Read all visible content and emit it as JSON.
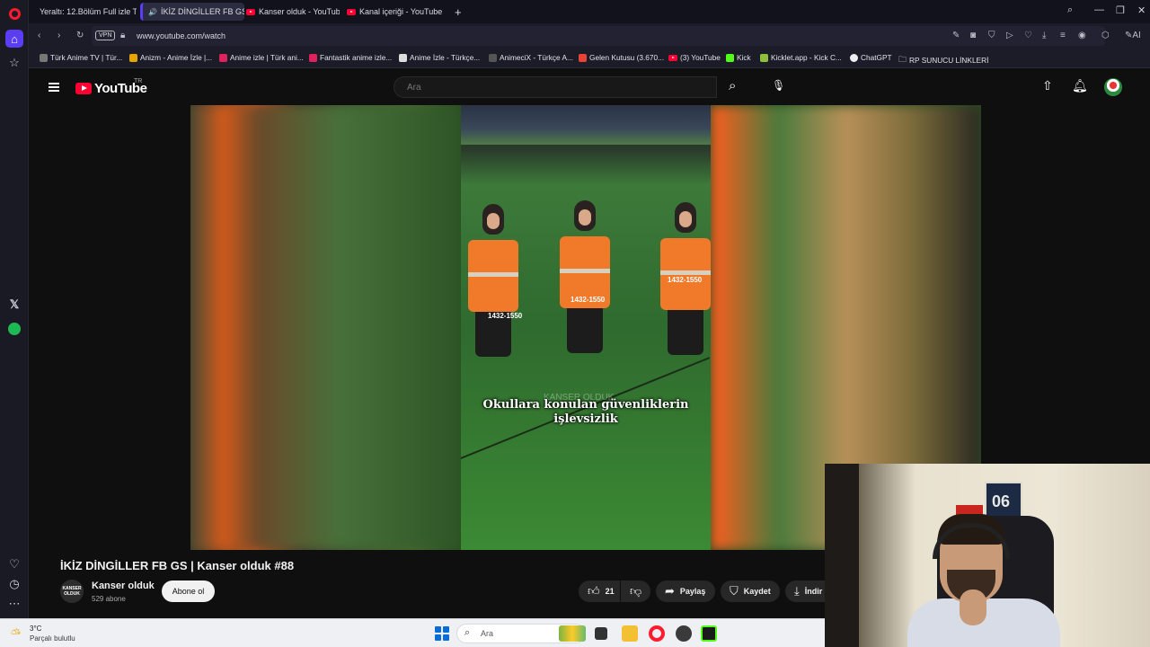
{
  "tabs": [
    {
      "label": "Yeraltı: 12.Bölüm Full izle T",
      "active": false
    },
    {
      "label": "İKİZ DİNGİLLER FB GS",
      "active": true
    },
    {
      "label": "Kanser olduk - YouTube",
      "active": false
    },
    {
      "label": "Kanal içeriği - YouTube St",
      "active": false
    }
  ],
  "address": {
    "vpn": "VPN",
    "url": "www.youtube.com/watch",
    "ai": "AI"
  },
  "bookmarks": [
    "Türk Anime TV | Tür...",
    "Anizm - Anime İzle |...",
    "Anime izle | Türk ani...",
    "Fantastik anime izle...",
    "Anime İzle - Türkçe...",
    "AnimeciX - Türkçe A...",
    "Gelen Kutusu (3.670...",
    "(3) YouTube",
    "Kick",
    "Kicklet.app - Kick C...",
    "ChatGPT",
    "RP SUNUCU LİNKLERİ"
  ],
  "youtube": {
    "logo": "YouTube",
    "region": "TR",
    "search_placeholder": "Ara"
  },
  "video": {
    "caption_line1": "Okullara konulan güvenliklerin",
    "caption_line2": "işlevsizlik",
    "watermark": "KANSER OLDUK",
    "vest_number": "1432-1550"
  },
  "meta": {
    "title": "İKİZ DİNGİLLER FB GS | Kanser olduk #88",
    "channel_avatar_text": "KANSER OLDUK",
    "channel": "Kanser olduk",
    "subscribers": "529 abone",
    "subscribe": "Abone ol",
    "likes": "21",
    "share": "Paylaş",
    "save": "Kaydet",
    "download": "İndir"
  },
  "webcam": {
    "poster": "06"
  },
  "taskbar": {
    "temp": "3°C",
    "weather": "Parçalı bulutlu",
    "search": "Ara"
  },
  "colors": {
    "youtube_red": "#ff0033",
    "opera_red": "#ff1b2d",
    "opera_accent": "#5a3df5",
    "steward_vest": "#f07a2a"
  }
}
